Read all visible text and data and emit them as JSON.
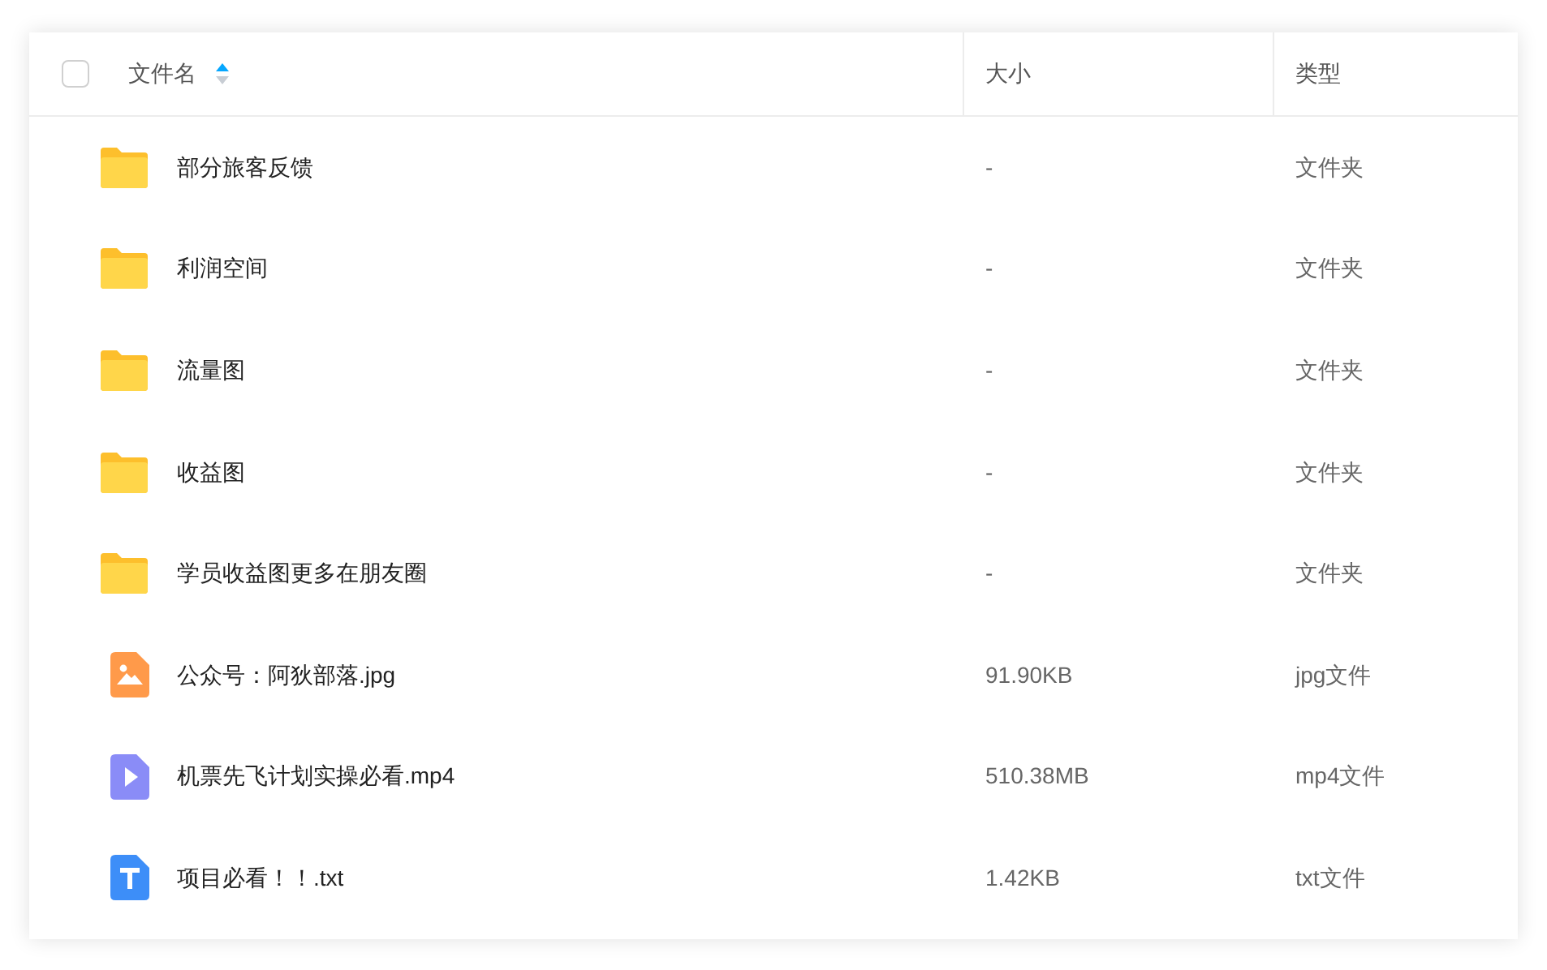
{
  "table": {
    "select_all": {
      "checked": false
    },
    "columns": [
      {
        "label": "文件名",
        "sort_ascending": true
      },
      {
        "label": "大小"
      },
      {
        "label": "类型"
      }
    ],
    "rows": [
      {
        "kind": "folder",
        "name": "部分旅客反馈",
        "size": "-",
        "type": "文件夹"
      },
      {
        "kind": "folder",
        "name": "利润空间",
        "size": "-",
        "type": "文件夹"
      },
      {
        "kind": "folder",
        "name": "流量图",
        "size": "-",
        "type": "文件夹"
      },
      {
        "kind": "folder",
        "name": "收益图",
        "size": "-",
        "type": "文件夹"
      },
      {
        "kind": "folder",
        "name": "学员收益图更多在朋友圈",
        "size": "-",
        "type": "文件夹"
      },
      {
        "kind": "image",
        "name": "公众号：阿狄部落.jpg",
        "size": "91.90KB",
        "type": "jpg文件"
      },
      {
        "kind": "video",
        "name": "机票先飞计划实操必看.mp4",
        "size": "510.38MB",
        "type": "mp4文件"
      },
      {
        "kind": "text",
        "name": "项目必看！！.txt",
        "size": "1.42KB",
        "type": "txt文件"
      }
    ]
  }
}
